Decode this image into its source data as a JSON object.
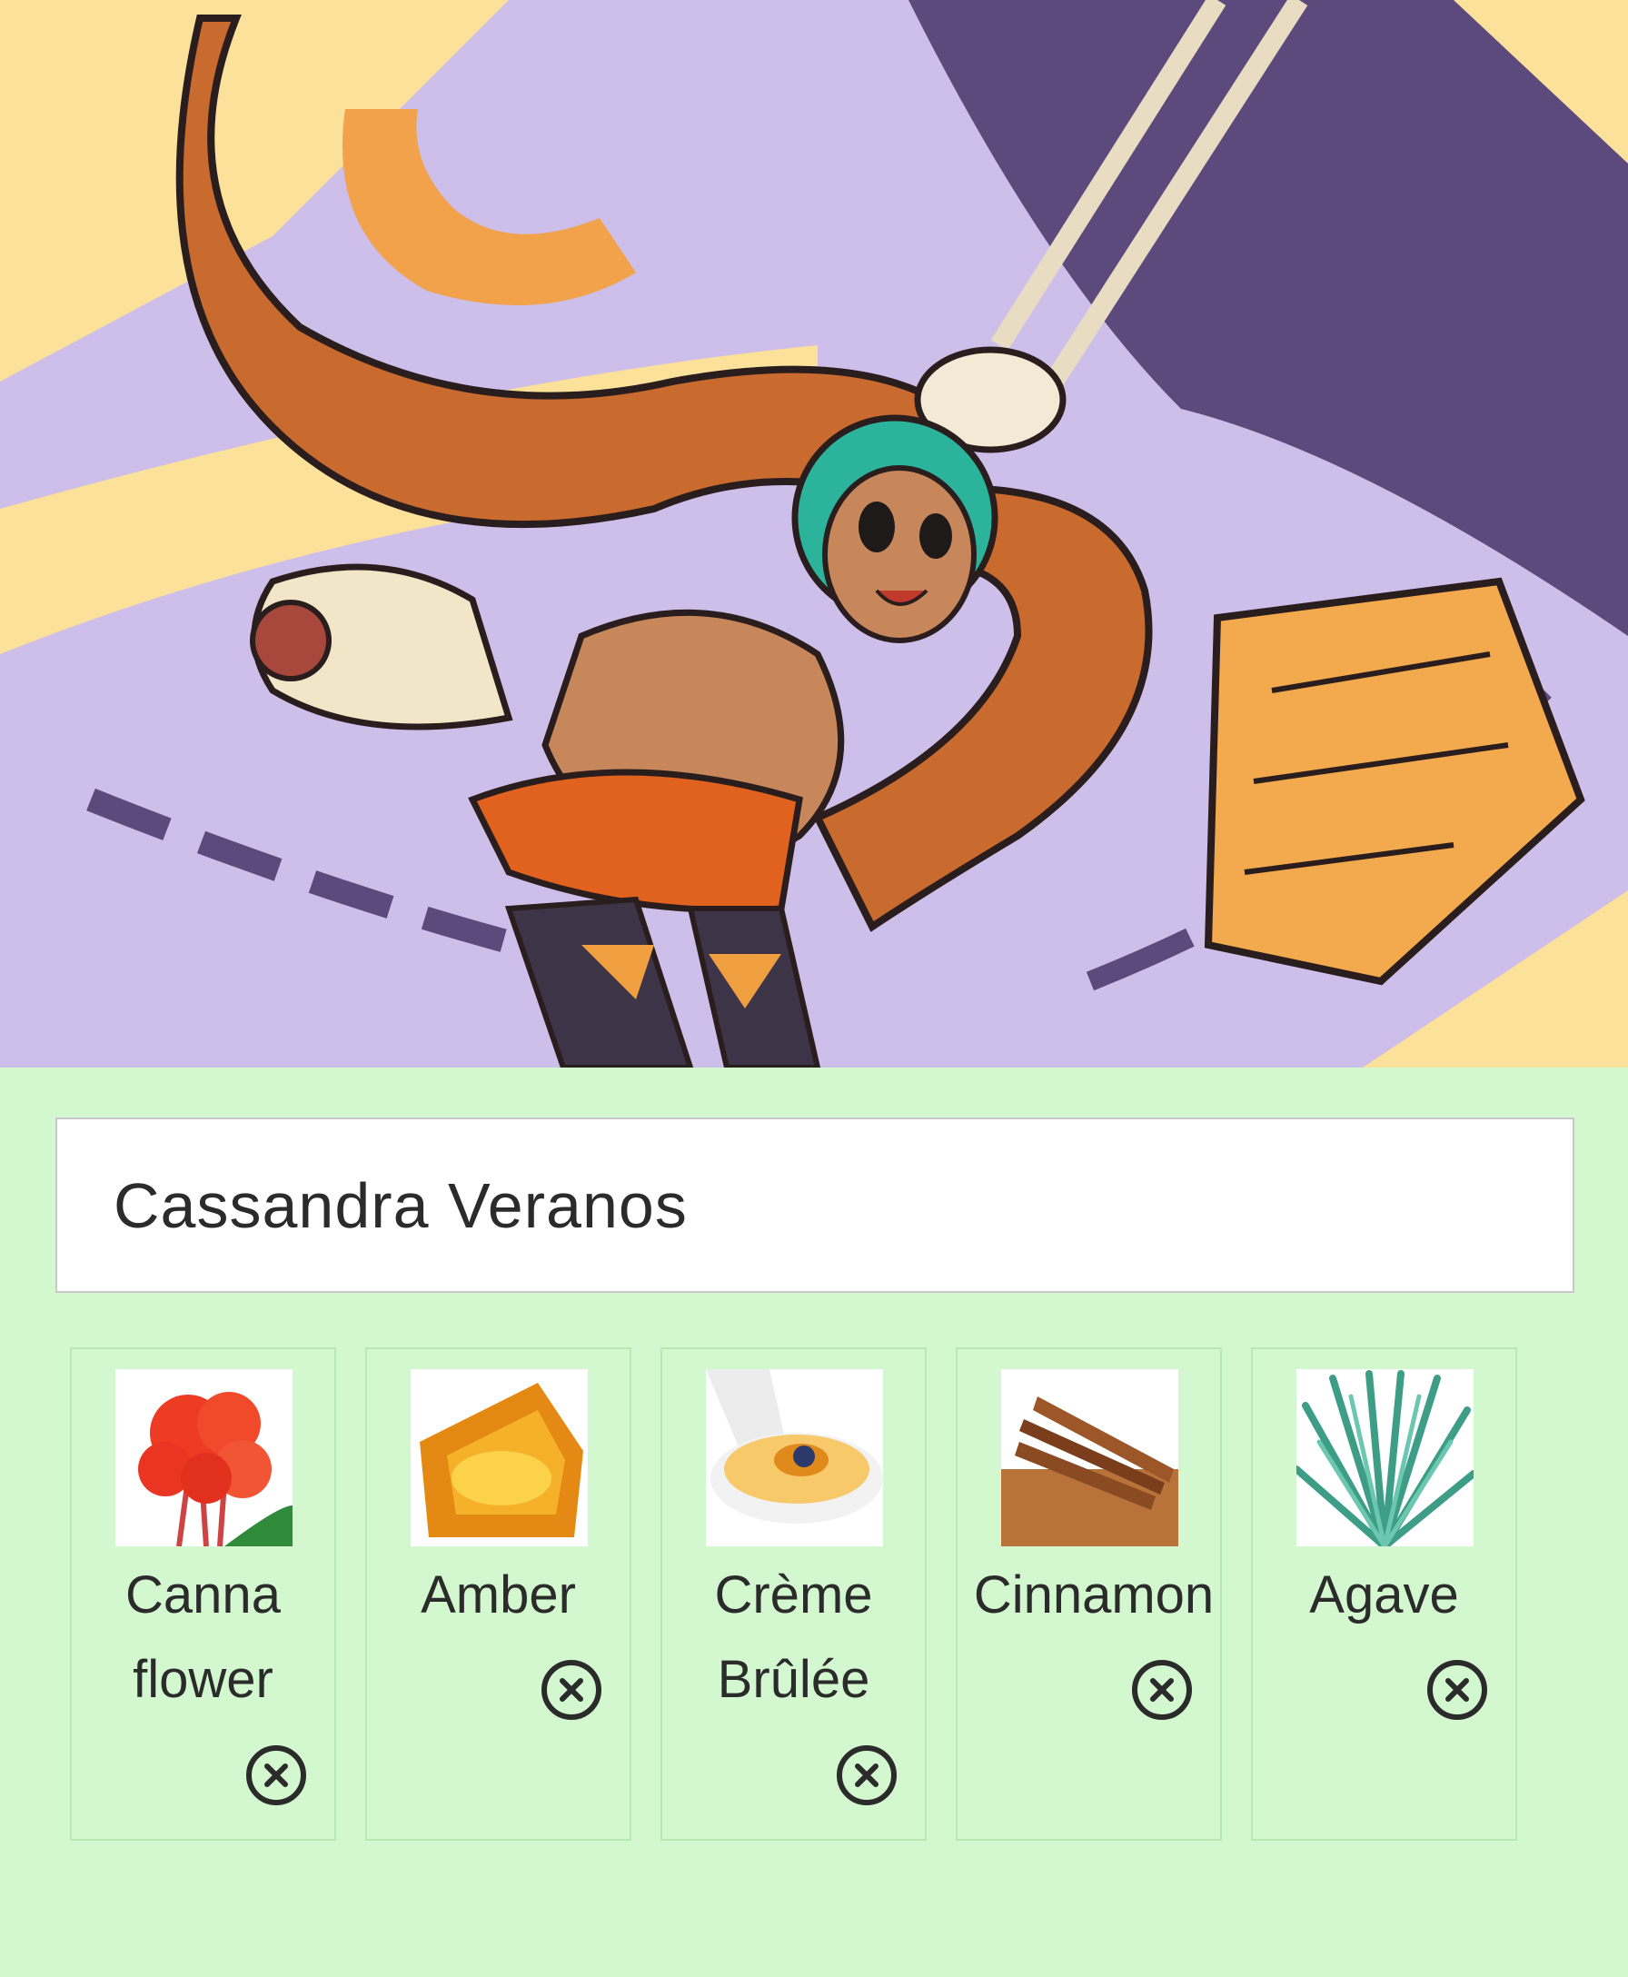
{
  "profile": {
    "name": "Cassandra Veranos"
  },
  "notes": [
    {
      "line1": "Canna",
      "line2": "flower",
      "icon": "canna-flower-image"
    },
    {
      "line1": "Amber",
      "line2": "",
      "icon": "amber-image"
    },
    {
      "line1": "Crème",
      "line2": "Brûlée",
      "icon": "creme-brulee-image"
    },
    {
      "line1": "Cinnamon",
      "line2": "",
      "icon": "cinnamon-image"
    },
    {
      "line1": "Agave",
      "line2": "",
      "icon": "agave-image"
    }
  ],
  "remove_icon": "close-circle-icon",
  "colors": {
    "panel_background": "#d3f8cf",
    "card_border": "#b9e8b4",
    "text": "#2b2b2b"
  }
}
